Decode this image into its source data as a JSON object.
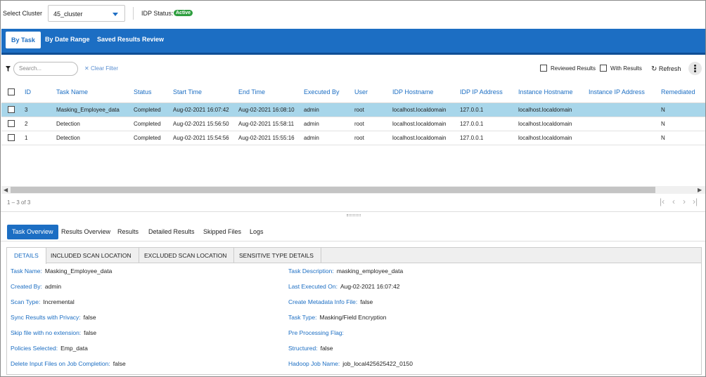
{
  "header": {
    "cluster_label": "Select Cluster",
    "cluster_value": "45_cluster",
    "idp_status_label": "IDP Status",
    "idp_status_badge": "Active",
    "badge_color": "#2e9e3f"
  },
  "main_tabs": [
    "By Task",
    "By Date Range",
    "Saved Results Review"
  ],
  "toolbar": {
    "search_placeholder": "Search...",
    "clear_filter": "Clear Filter",
    "reviewed_results": "Reviewed Results",
    "with_results": "With Results",
    "refresh": "Refresh"
  },
  "table": {
    "columns": [
      "ID",
      "Task Name",
      "Status",
      "Start Time",
      "End Time",
      "Executed By",
      "User",
      "IDP Hostname",
      "IDP IP Address",
      "Instance Hostname",
      "Instance IP Address",
      "Remediated"
    ],
    "rows": [
      [
        "3",
        "Masking_Employee_data",
        "Completed",
        "Aug-02-2021 16:07:42",
        "Aug-02-2021 16:08:10",
        "admin",
        "root",
        "localhost.localdomain",
        "127.0.0.1",
        "localhost.localdomain",
        "",
        "N"
      ],
      [
        "2",
        "Detection",
        "Completed",
        "Aug-02-2021 15:56:50",
        "Aug-02-2021 15:58:11",
        "admin",
        "root",
        "localhost.localdomain",
        "127.0.0.1",
        "localhost.localdomain",
        "",
        "N"
      ],
      [
        "1",
        "Detection",
        "Completed",
        "Aug-02-2021 15:54:56",
        "Aug-02-2021 15:55:16",
        "admin",
        "root",
        "localhost.localdomain",
        "127.0.0.1",
        "localhost.localdomain",
        "",
        "N"
      ]
    ],
    "selected_row": 0,
    "selected_color": "#a8d6ea"
  },
  "pager": {
    "count": "1 – 3 of 3"
  },
  "detail_tabs": [
    "Task Overview",
    "Results Overview",
    "Results",
    "Detailed Results",
    "Skipped Files",
    "Logs"
  ],
  "inner_tabs": [
    "DETAILS",
    "INCLUDED SCAN LOCATION",
    "EXCLUDED SCAN LOCATION",
    "SENSITIVE TYPE DETAILS"
  ],
  "details_left": [
    {
      "label": "Task Name:",
      "value": "Masking_Employee_data"
    },
    {
      "label": "Created By:",
      "value": "admin"
    },
    {
      "label": "Scan Type:",
      "value": "Incremental"
    },
    {
      "label": "Sync Results with Privacy:",
      "value": "false"
    },
    {
      "label": "Skip file with no extension:",
      "value": "false"
    },
    {
      "label": "Policies Selected:",
      "value": "Emp_data"
    },
    {
      "label": "Delete Input Files on Job Completion:",
      "value": "false"
    }
  ],
  "details_right": [
    {
      "label": "Task Description:",
      "value": "masking_employee_data"
    },
    {
      "label": "Last Executed On:",
      "value": "Aug-02-2021 16:07:42"
    },
    {
      "label": "Create Metadata Info File:",
      "value": "false"
    },
    {
      "label": "Task Type:",
      "value": "Masking/Field Encryption"
    },
    {
      "label": "Pre Processing Flag:",
      "value": ""
    },
    {
      "label": "Structured:",
      "value": "false"
    },
    {
      "label": "Hadoop Job Name:",
      "value": "job_local425625422_0150"
    }
  ],
  "colors": {
    "accent": "#1c6ec3"
  }
}
